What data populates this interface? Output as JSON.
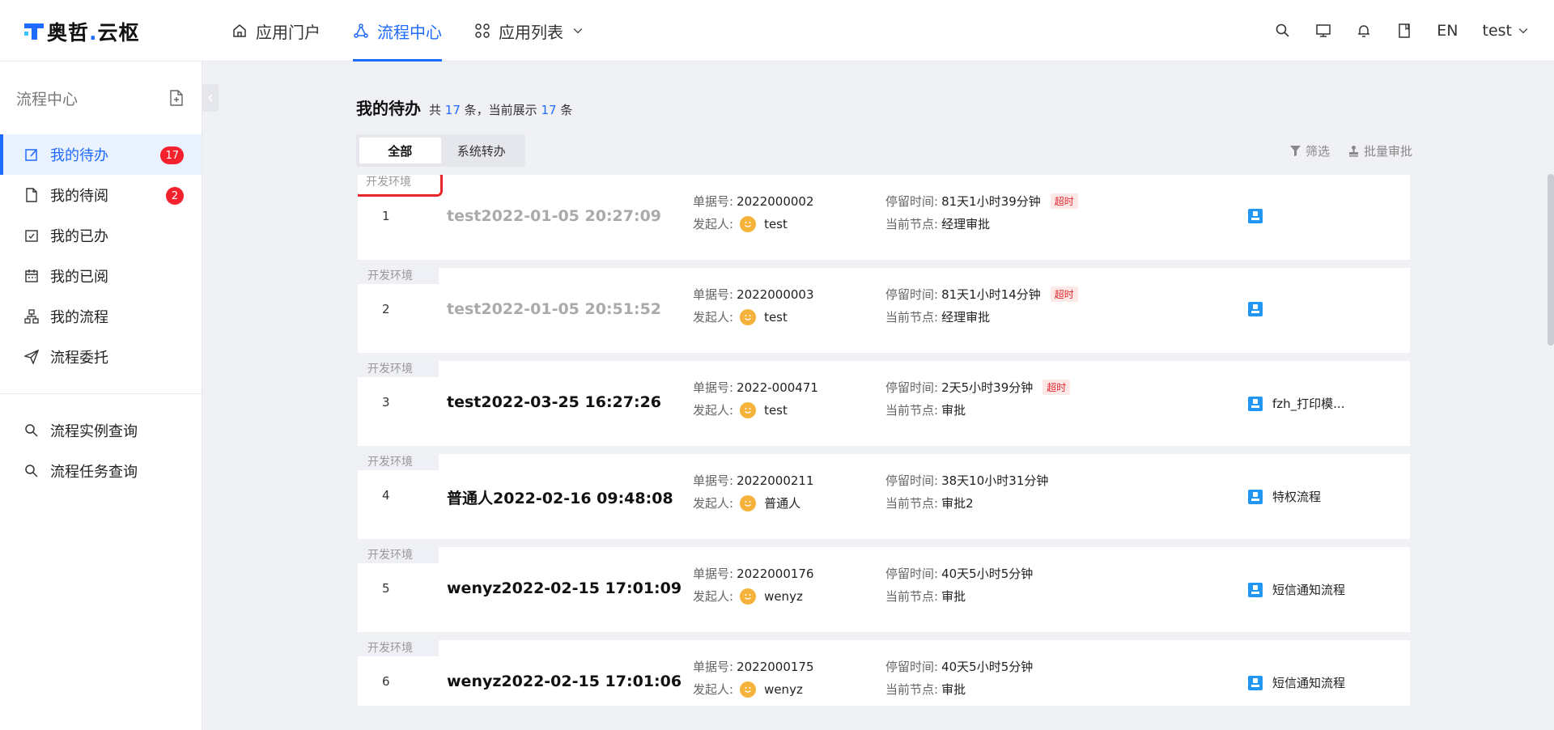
{
  "brand": {
    "name_a": "奥哲",
    "dot": ".",
    "name_b": "云枢"
  },
  "nav": [
    {
      "label": "应用门户"
    },
    {
      "label": "流程中心"
    },
    {
      "label": "应用列表"
    }
  ],
  "tools": {
    "lang": "EN",
    "user": "test"
  },
  "sidebar": {
    "title": "流程中心",
    "items": [
      {
        "label": "我的待办",
        "badge": "17"
      },
      {
        "label": "我的待阅",
        "badge": "2"
      },
      {
        "label": "我的已办"
      },
      {
        "label": "我的已阅"
      },
      {
        "label": "我的流程"
      },
      {
        "label": "流程委托"
      }
    ],
    "queries": [
      {
        "label": "流程实例查询"
      },
      {
        "label": "流程任务查询"
      }
    ]
  },
  "page": {
    "title": "我的待办",
    "count_prefix": "共",
    "total": "17",
    "count_mid": "条，当前展示",
    "shown": "17",
    "count_suffix": "条"
  },
  "tabs": [
    {
      "label": "全部"
    },
    {
      "label": "系统转办"
    }
  ],
  "actions": {
    "filter": "筛选",
    "batch": "批量审批"
  },
  "labels": {
    "env": "开发环境",
    "doc_no": "单据号:",
    "initiator": "发起人:",
    "stay": "停留时间:",
    "node": "当前节点:",
    "overtime": "超时"
  },
  "tasks": [
    {
      "index": "1",
      "title": "test2022-01-05 20:27:09",
      "doc_no": "2022000002",
      "initiator": "test",
      "stay": "81天1小时39分钟",
      "overtime": true,
      "node": "经理审批",
      "app": ""
    },
    {
      "index": "2",
      "title": "test2022-01-05 20:51:52",
      "doc_no": "2022000003",
      "initiator": "test",
      "stay": "81天1小时14分钟",
      "overtime": true,
      "node": "经理审批",
      "app": ""
    },
    {
      "index": "3",
      "title": "test2022-03-25 16:27:26",
      "doc_no": "2022-000471",
      "initiator": "test",
      "stay": "2天5小时39分钟",
      "overtime": true,
      "node": "审批",
      "app": "fzh_打印模..."
    },
    {
      "index": "4",
      "title": "普通人2022-02-16 09:48:08",
      "doc_no": "2022000211",
      "initiator": "普通人",
      "stay": "38天10小时31分钟",
      "overtime": false,
      "node": "审批2",
      "app": "特权流程"
    },
    {
      "index": "5",
      "title": "wenyz2022-02-15 17:01:09",
      "doc_no": "2022000176",
      "initiator": "wenyz",
      "stay": "40天5小时5分钟",
      "overtime": false,
      "node": "审批",
      "app": "短信通知流程"
    },
    {
      "index": "6",
      "title": "wenyz2022-02-15 17:01:06",
      "doc_no": "2022000175",
      "initiator": "wenyz",
      "stay": "40天5小时5分钟",
      "overtime": false,
      "node": "审批",
      "app": "短信通知流程"
    }
  ]
}
